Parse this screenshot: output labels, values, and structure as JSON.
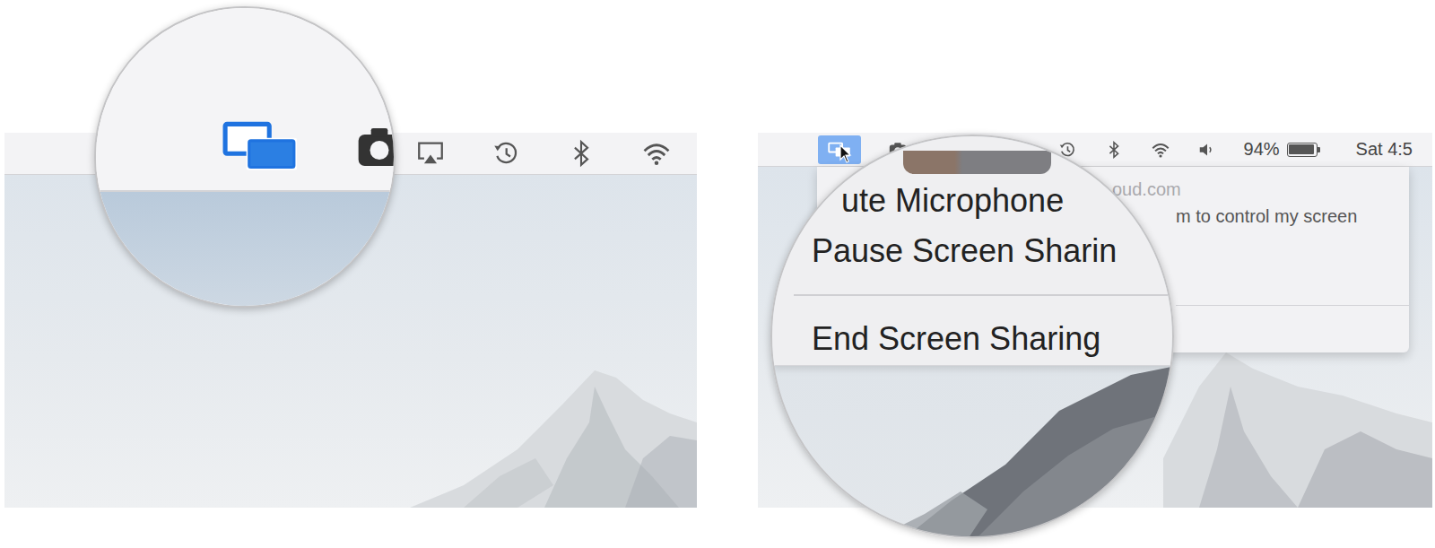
{
  "left_panel": {
    "magnifier": {
      "screen_sharing_icon": {
        "selected": false
      }
    }
  },
  "right_panel": {
    "menu_bar": {
      "screen_sharing_icon": {
        "selected": true
      },
      "battery": {
        "reading": "94%",
        "level": 0.94
      },
      "clock": "Sat 4:5"
    },
    "status_menu": {
      "lines": [
        "oud.com",
        "m to control my screen"
      ]
    },
    "magnifier": {
      "items": [
        {
          "label": "ute Microphone",
          "separator_before": false
        },
        {
          "label": "Pause Screen Sharin",
          "separator_before": false
        },
        {
          "label": "End Screen Sharing",
          "separator_before": true
        }
      ]
    }
  }
}
